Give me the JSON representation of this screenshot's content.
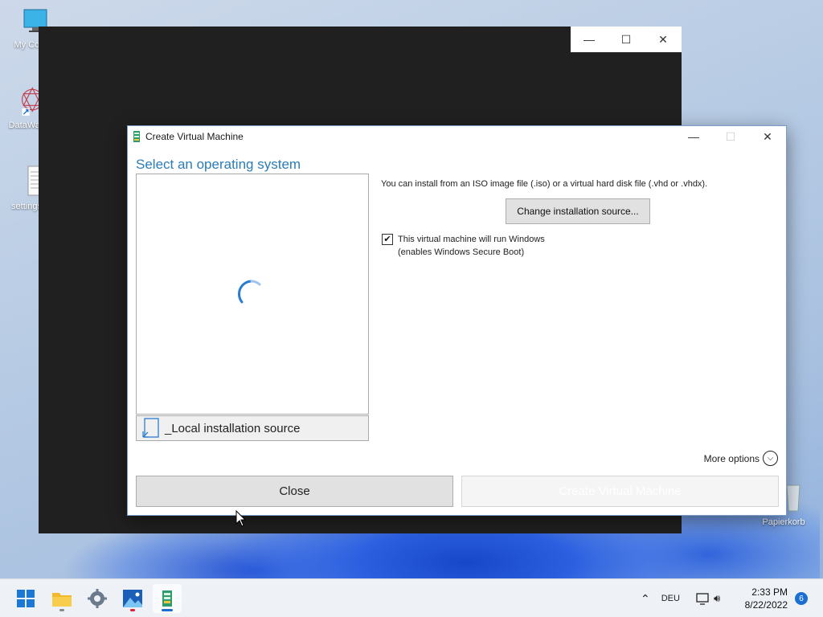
{
  "desktop": {
    "icons": [
      {
        "label": "My Com"
      },
      {
        "label": "DataWac"
      },
      {
        "label": "settings"
      },
      {
        "label": "Papierkorb"
      }
    ]
  },
  "dialog": {
    "title": "Create Virtual Machine",
    "heading": "Select an operating system",
    "local_source_label": "_Local installation source",
    "info_text": "You can install from an ISO image file (.iso) or a virtual hard disk file (.vhd or .vhdx).",
    "change_source_label": "Change installation source...",
    "windows_checkbox": {
      "checked": true,
      "line1": "This virtual machine will run Windows",
      "line2": "(enables Windows Secure Boot)"
    },
    "more_options_label": "More options",
    "close_label": "Close",
    "create_label": "Create Virtual Machine"
  },
  "taskbar": {
    "apps": [
      "start-icon",
      "file-explorer-icon",
      "settings-icon",
      "photos-icon",
      "hyperv-quick-create-icon"
    ],
    "language": "DEU",
    "time": "2:33 PM",
    "date": "8/22/2022",
    "notifications": "6"
  }
}
